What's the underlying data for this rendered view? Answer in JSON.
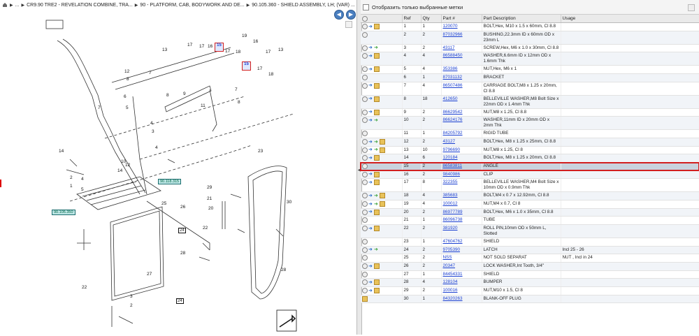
{
  "breadcrumb": [
    {
      "label": ""
    },
    {
      "label": "..."
    },
    {
      "label": "CR9.90 TRE2 - REVELATION COMBINE, TRA..."
    },
    {
      "label": "90 - PLATFORM, CAB, BODYWORK AND DE..."
    },
    {
      "label": "90.105.360 - SHIELD ASSEMBLY, LH; (VAR) ..."
    }
  ],
  "nav": {
    "back": "◀",
    "forward": "▶"
  },
  "filter_label": "Отобразить только выбранные метки",
  "columns": {
    "ref": "Ref",
    "qty": "Qty",
    "part": "Part #",
    "desc": "Part Description",
    "usage": "Usage"
  },
  "diagram": {
    "ref_box_1": "90.118.315",
    "ref_box_2": "90.105.350",
    "highlight_a": "15",
    "highlight_b": "15",
    "callouts": [
      "13",
      "17",
      "18",
      "16",
      "15",
      "17",
      "19",
      "16",
      "17",
      "15",
      "17",
      "18",
      "13",
      "12",
      "7",
      "8",
      "6",
      "5",
      "11",
      "10",
      "8",
      "9",
      "7",
      "8",
      "10",
      "14",
      "4",
      "3",
      "4",
      "2",
      "1",
      "3",
      "4",
      "5",
      "12",
      "10",
      "14",
      "2",
      "23",
      "29",
      "21",
      "20",
      "22",
      "30",
      "27",
      "25",
      "26",
      "24",
      "28",
      "22",
      "2",
      "3",
      "24"
    ]
  },
  "rows": [
    {
      "icons": [
        "plus",
        "blue",
        "box"
      ],
      "ref": "1",
      "qty": "1",
      "part": "120070",
      "desc": "BOLT,Hex, M10 x 1.5 x 60mm, Cl 8.8",
      "usage": ""
    },
    {
      "icons": [
        "plus"
      ],
      "ref": "2",
      "qty": "2",
      "part": "87032966",
      "desc": "BUSHING,22.3mm ID x 60mm OD x 23mm L",
      "usage": ""
    },
    {
      "icons": [
        "plus",
        "blue",
        "green"
      ],
      "ref": "3",
      "qty": "2",
      "part": "43117",
      "desc": "SCREW,Hex, M6 x 1.0 x 30mm, Cl 8.8",
      "usage": ""
    },
    {
      "icons": [
        "plus",
        "blue",
        "box"
      ],
      "ref": "4",
      "qty": "4",
      "part": "86588450",
      "desc": "WASHER,6.6mm ID x 12mm OD x 1.6mm Thk",
      "usage": ""
    },
    {
      "icons": [
        "plus",
        "blue",
        "box"
      ],
      "ref": "5",
      "qty": "4",
      "part": "353386",
      "desc": "NUT,Hex, M6 x 1",
      "usage": ""
    },
    {
      "icons": [
        "plus"
      ],
      "ref": "6",
      "qty": "1",
      "part": "87031132",
      "desc": "BRACKET",
      "usage": ""
    },
    {
      "icons": [
        "plus",
        "blue",
        "box"
      ],
      "ref": "7",
      "qty": "4",
      "part": "86507486",
      "desc": "CARRIAGE BOLT,M8 x 1.25 x 20mm, Cl 8.8",
      "usage": ""
    },
    {
      "icons": [
        "plus",
        "blue",
        "box"
      ],
      "ref": "8",
      "qty": "18",
      "part": "412650",
      "desc": "BELLEVILLE WASHER,M8 Bolt Size x 22mm OD x 1.4mm Thk",
      "usage": ""
    },
    {
      "icons": [
        "plus",
        "blue",
        "box"
      ],
      "ref": "9",
      "qty": "2",
      "part": "86629542",
      "desc": "NUT,M8 x 1.25, Cl 8.8",
      "usage": ""
    },
    {
      "icons": [
        "plus",
        "blue",
        "green"
      ],
      "ref": "10",
      "qty": "2",
      "part": "86624176",
      "desc": "WASHER,11mm ID x 20mm OD x 2mm Thk",
      "usage": ""
    },
    {
      "icons": [
        "plus"
      ],
      "ref": "11",
      "qty": "1",
      "part": "84205792",
      "desc": "RIGID TUBE",
      "usage": ""
    },
    {
      "icons": [
        "plus",
        "blue",
        "green",
        "box"
      ],
      "ref": "12",
      "qty": "2",
      "part": "43127",
      "desc": "BOLT,Hex, M8 x 1.25 x 25mm, Cl 8.8",
      "usage": ""
    },
    {
      "icons": [
        "plus",
        "blue",
        "green",
        "box"
      ],
      "ref": "13",
      "qty": "10",
      "part": "9796690",
      "desc": "NUT,M8 x 1.25, Cl 8",
      "usage": ""
    },
    {
      "icons": [
        "plus",
        "blue",
        "box"
      ],
      "ref": "14",
      "qty": "6",
      "part": "120184",
      "desc": "BOLT,Hex, M8 x 1.25 x 20mm, Cl 8.8",
      "usage": ""
    },
    {
      "icons": [
        "plus"
      ],
      "ref": "15",
      "qty": "2",
      "part": "86583811",
      "desc": "ANGLE",
      "usage": "",
      "selected": true
    },
    {
      "icons": [
        "plus",
        "blue",
        "box"
      ],
      "ref": "16",
      "qty": "2",
      "part": "9840986",
      "desc": "CLIP",
      "usage": ""
    },
    {
      "icons": [
        "plus",
        "blue",
        "box"
      ],
      "ref": "17",
      "qty": "8",
      "part": "322355",
      "desc": "BELLEVILLE WASHER,M4 Bolt Size x 10mm OD x 0.9mm Thk",
      "usage": ""
    },
    {
      "icons": [
        "plus",
        "blue",
        "green",
        "box"
      ],
      "ref": "18",
      "qty": "4",
      "part": "385683",
      "desc": "BOLT,M4 x 0.7 x 12.92mm, Cl 8.8",
      "usage": ""
    },
    {
      "icons": [
        "plus",
        "blue",
        "green",
        "box"
      ],
      "ref": "19",
      "qty": "4",
      "part": "100012",
      "desc": "NUT,M4 x 0.7, Cl 8",
      "usage": ""
    },
    {
      "icons": [
        "plus",
        "blue",
        "box"
      ],
      "ref": "20",
      "qty": "2",
      "part": "86977789",
      "desc": "BOLT,Hex, M6 x 1.0 x 35mm, Cl 8.8",
      "usage": ""
    },
    {
      "icons": [
        "plus"
      ],
      "ref": "21",
      "qty": "1",
      "part": "86096738",
      "desc": "TUBE",
      "usage": ""
    },
    {
      "icons": [
        "plus",
        "blue",
        "box"
      ],
      "ref": "22",
      "qty": "2",
      "part": "381920",
      "desc": "ROLL PIN,10mm OD x 50mm L, Slotted",
      "usage": ""
    },
    {
      "icons": [
        "plus"
      ],
      "ref": "23",
      "qty": "1",
      "part": "47604762",
      "desc": "SHIELD",
      "usage": ""
    },
    {
      "icons": [
        "plus",
        "blue",
        "green"
      ],
      "ref": "24",
      "qty": "2",
      "part": "9705390",
      "desc": "LATCH",
      "usage": "Incl 25 - 26"
    },
    {
      "icons": [
        "plus"
      ],
      "ref": "25",
      "qty": "2",
      "part": "NSS",
      "desc": "NOT SOLD SEPARAT",
      "usage": "NUT , Incl in 24"
    },
    {
      "icons": [
        "plus",
        "blue",
        "box"
      ],
      "ref": "26",
      "qty": "2",
      "part": "20347",
      "desc": "LOCK WASHER,Int Tooth, 3/4\"",
      "usage": ""
    },
    {
      "icons": [
        "plus"
      ],
      "ref": "27",
      "qty": "1",
      "part": "84454331",
      "desc": "SHIELD",
      "usage": ""
    },
    {
      "icons": [
        "plus",
        "blue",
        "box"
      ],
      "ref": "28",
      "qty": "4",
      "part": "128104",
      "desc": "BUMPER",
      "usage": ""
    },
    {
      "icons": [
        "plus",
        "blue",
        "box"
      ],
      "ref": "29",
      "qty": "2",
      "part": "100016",
      "desc": "NUT,M10 x 1.5, Cl 8",
      "usage": ""
    },
    {
      "icons": [
        "box"
      ],
      "ref": "30",
      "qty": "1",
      "part": "84320263",
      "desc": "BLANK-OFF PLUG",
      "usage": ""
    }
  ]
}
